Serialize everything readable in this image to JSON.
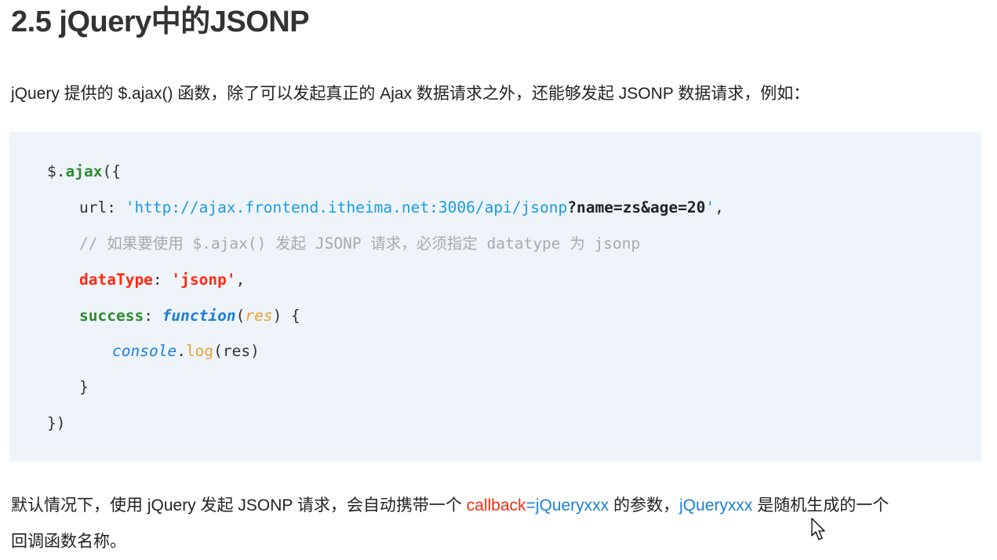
{
  "title": "2.5 jQuery中的JSONP",
  "intro": "jQuery 提供的 $.ajax() 函数，除了可以发起真正的 Ajax 数据请求之外，还能够发起 JSONP 数据请求，例如：",
  "code": {
    "line1": {
      "a": "$.",
      "b": "ajax",
      "c": "({"
    },
    "line2": {
      "a": "url: ",
      "b": "'http://ajax.frontend.itheima.net:3006/api/jsonp",
      "c": "?name=zs&age=20",
      "d": "'",
      "e": ","
    },
    "line3": {
      "a": "// 如果要使用 $.ajax() 发起 JSONP 请求，必须指定 datatype 为 jsonp"
    },
    "line4": {
      "a": "dataType",
      "b": ": ",
      "c": "'jsonp'",
      "d": ","
    },
    "line5": {
      "a": "success",
      "b": ": ",
      "c": "function",
      "d": "(",
      "e": "res",
      "f": ") {"
    },
    "line6": {
      "a": "console",
      "b": ".",
      "c": "log",
      "d": "(res)"
    },
    "line7": {
      "a": "}"
    },
    "line8": {
      "a": "})"
    }
  },
  "footer": {
    "p1": "默认情况下，使用 jQuery 发起 JSONP 请求，会自动携带一个 ",
    "callback": "callback",
    "eq": "=",
    "jq1": "jQueryxxx",
    "p2": " 的参数，",
    "jq2": "jQueryxxx",
    "p3": " 是随机生成的一个",
    "line2": "回调函数名称。"
  },
  "colors": {
    "code_background": "#eff4fb",
    "string_blue": "#1a9be0",
    "keyword_red": "#ff2a10",
    "function_green": "#2e8b2e",
    "keyword_blue": "#1a7fd8",
    "param_orange": "#f0a030",
    "comment_gray": "#a9a9a9"
  },
  "icons": {
    "cursor": "mouse-pointer-icon"
  }
}
